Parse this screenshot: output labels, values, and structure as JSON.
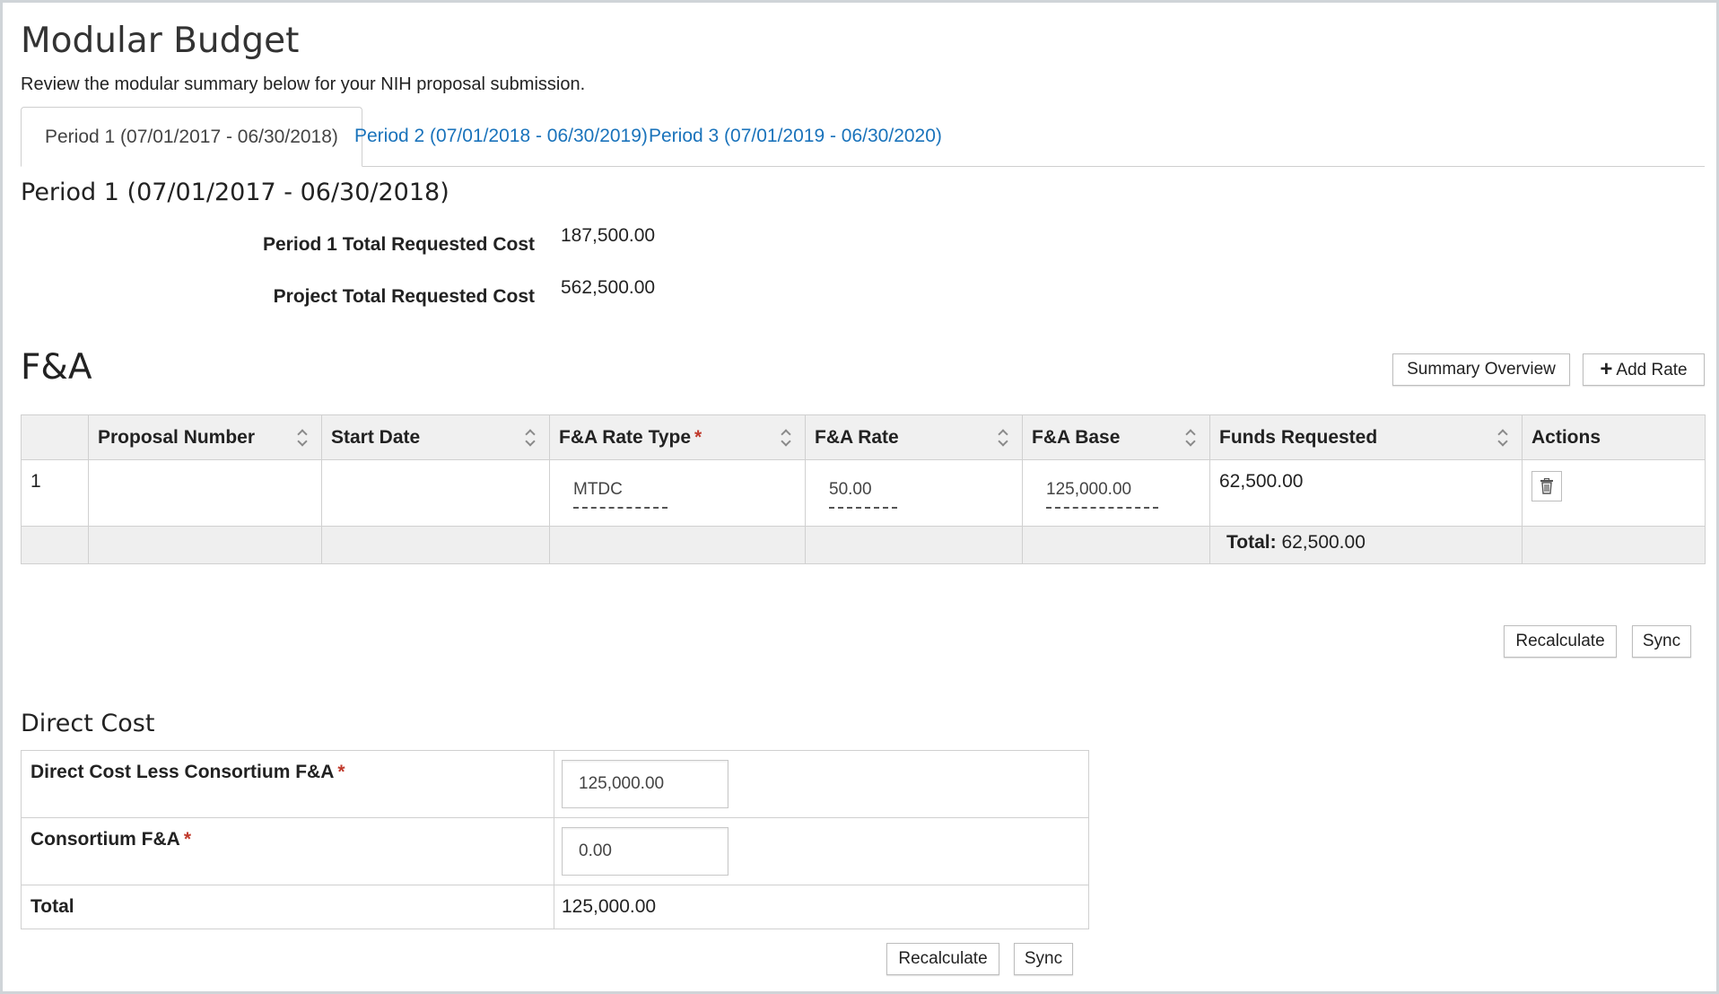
{
  "header": {
    "title": "Modular Budget",
    "subtitle": "Review the modular summary below for your NIH proposal submission."
  },
  "tabs": [
    {
      "label": "Period 1 (07/01/2017 - 06/30/2018)",
      "active": true
    },
    {
      "label": "Period 2 (07/01/2018 - 06/30/2019)",
      "active": false
    },
    {
      "label": "Period 3 (07/01/2019 - 06/30/2020)",
      "active": false
    }
  ],
  "period": {
    "heading": "Period 1 (07/01/2017 - 06/30/2018)",
    "period_total_label": "Period 1 Total Requested Cost",
    "period_total_value": "187,500.00",
    "project_total_label": "Project Total Requested Cost",
    "project_total_value": "562,500.00"
  },
  "fa": {
    "heading": "F&A",
    "summary_button": "Summary Overview",
    "add_rate_button": "Add Rate",
    "columns": [
      "",
      "Proposal Number",
      "Start Date",
      "F&A Rate Type",
      "F&A Rate",
      "F&A Base",
      "Funds Requested",
      "Actions"
    ],
    "rows": [
      {
        "index": "1",
        "proposal_number": "",
        "start_date": "",
        "rate_type": "MTDC",
        "rate": "50.00",
        "base": "125,000.00",
        "funds": "62,500.00"
      }
    ],
    "total_label": "Total:",
    "total_value": "62,500.00",
    "recalculate_button": "Recalculate",
    "sync_button": "Sync"
  },
  "direct_cost": {
    "heading": "Direct Cost",
    "less_consortium_label": "Direct Cost Less Consortium F&A",
    "less_consortium_value": "125,000.00",
    "consortium_label": "Consortium F&A",
    "consortium_value": "0.00",
    "total_label": "Total",
    "total_value": "125,000.00",
    "recalculate_button": "Recalculate",
    "sync_button": "Sync"
  },
  "colors": {
    "link": "#1a73bb",
    "required": "#c0392b",
    "frame_border": "#cfd4d8",
    "header_bg": "#f0f0f0"
  }
}
